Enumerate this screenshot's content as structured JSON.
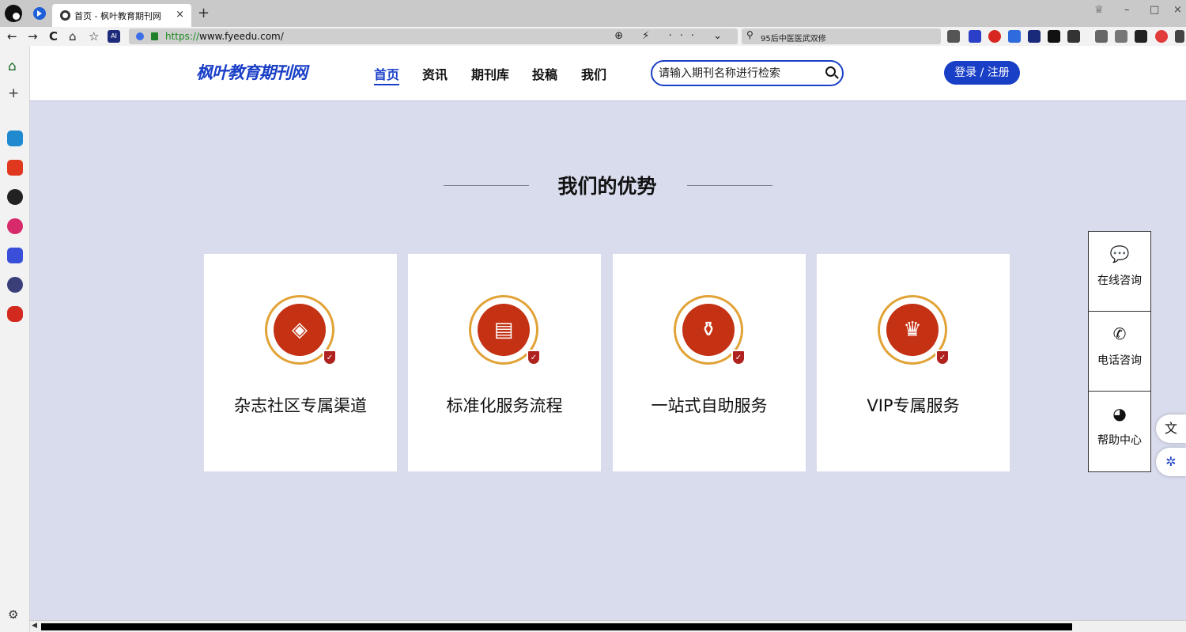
{
  "browser": {
    "tab_title": "首页 - 枫叶教育期刊网",
    "url_scheme": "https://",
    "url_rest": "www.fyeedu.com/",
    "search_value": "95后中医医武双修",
    "url_icons": "⊕ ⚡ ··· ⌄",
    "nav": {
      "back": "←",
      "forward": "→",
      "reload": "C",
      "home": "⌂",
      "bookmark": "☆"
    },
    "nav_ai": "AI",
    "new_tab": "+",
    "close_tab": "×",
    "window_controls": {
      "shirt": "♕",
      "minimize": "–",
      "maximize": "□",
      "close": "×"
    },
    "sidebar_glyphs": {
      "home": "⌂",
      "add": "+",
      "settings": "⚙"
    },
    "accent_colors": {
      "brand_blue": "#1a3fc7",
      "icon_red": "#c43113",
      "icon_gold": "#e1a236",
      "page_bg": "#d8dced"
    }
  },
  "site": {
    "logo": "枫叶教育期刊网",
    "nav": [
      {
        "label": "首页",
        "active": true
      },
      {
        "label": "资讯"
      },
      {
        "label": "期刊库"
      },
      {
        "label": "投稿"
      },
      {
        "label": "我们"
      }
    ],
    "search_placeholder": "请输入期刊名称进行检索",
    "login_label": "登录 / 注册"
  },
  "section": {
    "title": "我们的优势",
    "cards": [
      {
        "label": "杂志社区专属渠道",
        "icon": "diamond-check-icon"
      },
      {
        "label": "标准化服务流程",
        "icon": "document-icon"
      },
      {
        "label": "一站式自助服务",
        "icon": "bottle-icon"
      },
      {
        "label": "VIP专属服务",
        "icon": "crown-icon"
      }
    ]
  },
  "float_panel": {
    "items": [
      {
        "label": "在线咨询",
        "icon": "chat-bubble-icon"
      },
      {
        "label": "电话咨询",
        "icon": "phone-icon"
      },
      {
        "label": "帮助中心",
        "icon": "help-person-icon"
      }
    ]
  }
}
